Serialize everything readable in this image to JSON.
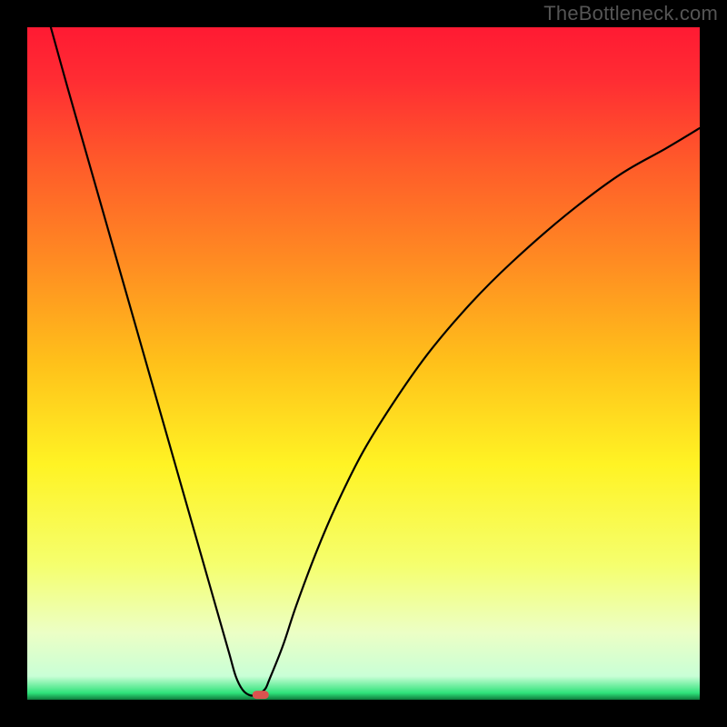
{
  "watermark": "TheBottleneck.com",
  "chart_data": {
    "type": "line",
    "title": "",
    "xlabel": "",
    "ylabel": "",
    "xlim": [
      0,
      100
    ],
    "ylim": [
      0,
      100
    ],
    "x": [
      3.5,
      6,
      8,
      10,
      12,
      14,
      16,
      18,
      20,
      22,
      24,
      26,
      28,
      30,
      31,
      32,
      33,
      34,
      35.3,
      36,
      38,
      40,
      43,
      46,
      50,
      55,
      60,
      66,
      72,
      80,
      88,
      95,
      100
    ],
    "y": [
      100,
      91,
      84,
      77,
      70,
      63,
      56,
      49,
      42,
      35,
      28,
      21,
      14,
      7,
      3.5,
      1.5,
      0.7,
      0.7,
      1.5,
      3,
      8,
      14,
      22,
      29,
      37,
      45,
      52,
      59,
      65,
      72,
      78,
      82,
      85
    ],
    "marker": {
      "x": 34.7,
      "y": 0.8,
      "color": "#d9534f"
    },
    "gradient_stops": [
      {
        "pos": 0.0,
        "color": "#ff1a33"
      },
      {
        "pos": 0.08,
        "color": "#ff2d33"
      },
      {
        "pos": 0.2,
        "color": "#ff5a2a"
      },
      {
        "pos": 0.35,
        "color": "#ff8c22"
      },
      {
        "pos": 0.5,
        "color": "#ffc11a"
      },
      {
        "pos": 0.65,
        "color": "#fff324"
      },
      {
        "pos": 0.8,
        "color": "#f5ff6e"
      },
      {
        "pos": 0.9,
        "color": "#ecffc5"
      },
      {
        "pos": 0.965,
        "color": "#c9ffd6"
      },
      {
        "pos": 0.99,
        "color": "#2ee27a"
      },
      {
        "pos": 1.0,
        "color": "#0f7a3c"
      }
    ]
  }
}
